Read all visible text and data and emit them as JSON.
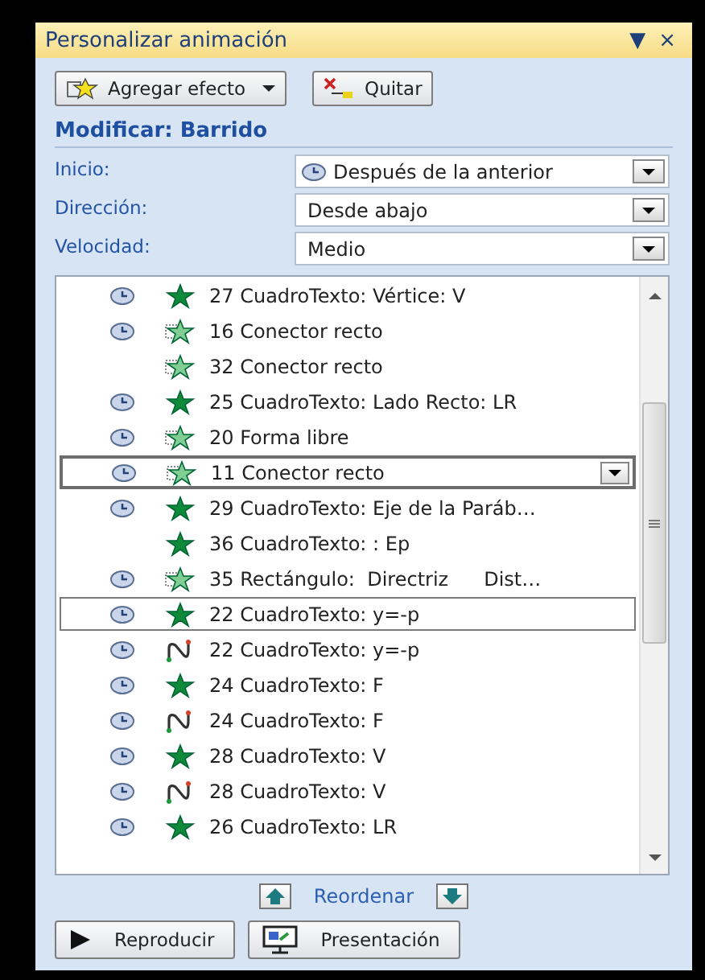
{
  "pane": {
    "title": "Personalizar animación",
    "menu_glyph": "▼",
    "close_glyph": "×"
  },
  "toolbar": [
    {
      "kind": "add",
      "label": "Agregar efecto",
      "dropdown": true
    },
    {
      "kind": "remove",
      "label": "Quitar",
      "dropdown": false
    }
  ],
  "section_title": "Modificar: Barrido",
  "fields": [
    {
      "label": "Inicio:",
      "value": "Después de la anterior",
      "clock": true
    },
    {
      "label": "Dirección:",
      "value": "Desde abajo",
      "clock": false
    },
    {
      "label": "Velocidad:",
      "value": "Medio",
      "clock": false
    }
  ],
  "effects": [
    {
      "label": "27 CuadroTexto: Vértice: V",
      "clock": true,
      "kind": "star",
      "selected": false,
      "focused": false
    },
    {
      "label": "16 Conector recto",
      "clock": true,
      "kind": "star-faded",
      "selected": false,
      "focused": false
    },
    {
      "label": "32 Conector recto",
      "clock": false,
      "kind": "star-faded",
      "selected": false,
      "focused": false
    },
    {
      "label": "25 CuadroTexto: Lado Recto: LR",
      "clock": true,
      "kind": "star",
      "selected": false,
      "focused": false
    },
    {
      "label": "20 Forma libre",
      "clock": true,
      "kind": "star-faded",
      "selected": false,
      "focused": false
    },
    {
      "label": "11 Conector recto",
      "clock": true,
      "kind": "star-faded",
      "selected": true,
      "focused": false
    },
    {
      "label": "29 CuadroTexto: Eje de la Paráb…",
      "clock": true,
      "kind": "star",
      "selected": false,
      "focused": false
    },
    {
      "label": "36 CuadroTexto: : Ep",
      "clock": false,
      "kind": "star",
      "selected": false,
      "focused": false
    },
    {
      "label": "35 Rectángulo:  Directriz",
      "extra": "Dist…",
      "clock": true,
      "kind": "star-faded",
      "selected": false,
      "focused": false
    },
    {
      "label": "22 CuadroTexto: y=-p",
      "clock": true,
      "kind": "star",
      "selected": false,
      "focused": true
    },
    {
      "label": "22 CuadroTexto: y=-p",
      "clock": true,
      "kind": "path",
      "selected": false,
      "focused": false
    },
    {
      "label": "24 CuadroTexto: F",
      "clock": true,
      "kind": "star",
      "selected": false,
      "focused": false
    },
    {
      "label": "24 CuadroTexto: F",
      "clock": true,
      "kind": "path",
      "selected": false,
      "focused": false
    },
    {
      "label": "28 CuadroTexto: V",
      "clock": true,
      "kind": "star",
      "selected": false,
      "focused": false
    },
    {
      "label": "28 CuadroTexto: V",
      "clock": true,
      "kind": "path",
      "selected": false,
      "focused": false
    },
    {
      "label": "26 CuadroTexto: LR",
      "clock": true,
      "kind": "star",
      "selected": false,
      "focused": false
    }
  ],
  "reorder_label": "Reordenar",
  "footer": [
    {
      "kind": "play",
      "label": "Reproducir"
    },
    {
      "kind": "show",
      "label": "Presentación"
    }
  ]
}
